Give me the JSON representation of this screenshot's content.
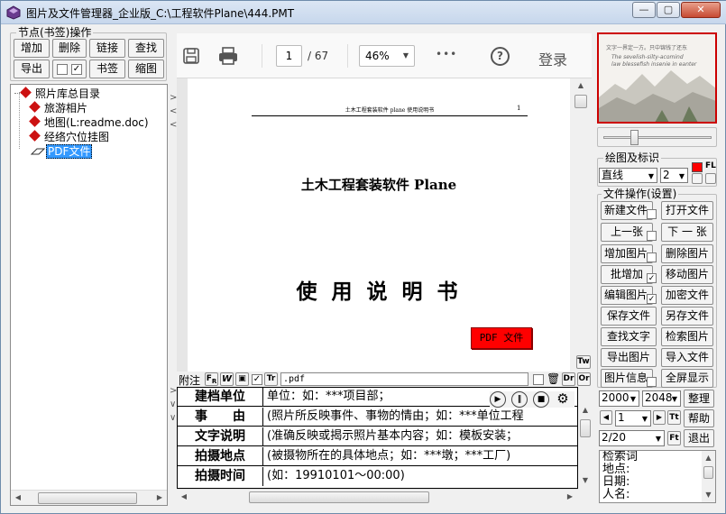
{
  "window": {
    "title": "图片及文件管理器_企业版_C:\\工程软件Plane\\444.PMT",
    "caption_min": "—",
    "caption_max": "▢",
    "caption_close": "✕"
  },
  "colors": {
    "accent_red": "#ff0000",
    "title_bar": "#c7d7ec"
  },
  "nodes": {
    "group_title": "节点(书签)操作",
    "add": "增加",
    "delete": "删除",
    "link": "链接",
    "find": "查找",
    "export": "导出",
    "bookmark": "书签",
    "thumbnail": "缩图"
  },
  "tree": {
    "root": "照片库总目录",
    "items": [
      "旅游相片",
      "地图(L:readme.doc)",
      "经络穴位挂图",
      "PDF文件"
    ]
  },
  "viewer": {
    "page_current": "1",
    "page_total": "/ 67",
    "zoom": "46%",
    "more": "•••",
    "help": "?",
    "login": "登录"
  },
  "doc": {
    "header_text": "土木工程套装软件 plane 使用说明书",
    "header_page": "1",
    "title": "土木工程套装软件 Plane",
    "subtitle": "使 用 说 明 书",
    "pdf_badge": "PDF 文件"
  },
  "attach": {
    "label": "附注",
    "ext": ".pdf",
    "tw": "Tw",
    "tr": "Tr",
    "dr": "Dr",
    "or": "Or"
  },
  "info": {
    "rows": [
      {
        "label": "建档单位",
        "value": "单位：如：***项目部；"
      },
      {
        "label": "事　　由",
        "value": "(照片所反映事件、事物的情由；如：***单位工程"
      },
      {
        "label": "文字说明",
        "value": "(准确反映或揭示照片基本内容；如：模板安装；"
      },
      {
        "label": "拍摄地点",
        "value": "(被摄物所在的具体地点；如：***墩；***工厂)"
      },
      {
        "label": "拍摄时间",
        "value": "(如：19910101～00:00)"
      }
    ]
  },
  "draw": {
    "title": "绘图及标识",
    "line_type": "直线",
    "width": "2",
    "fl": "FL"
  },
  "file": {
    "title": "文件操作(设置)",
    "buttons": [
      "新建文件",
      "打开文件",
      "上一张",
      "下 一 张",
      "增加图片",
      "删除图片",
      "批增加",
      "移动图片",
      "编辑图片",
      "加密文件",
      "保存文件",
      "另存文件",
      "查找文字",
      "检索图片",
      "导出图片",
      "导入文件",
      "图片信息",
      "全屏显示"
    ]
  },
  "bottom": {
    "year_from": "2000",
    "year_to": "2048",
    "sort": "整理",
    "page_sel": "1",
    "help": "帮助",
    "page_count": "2/20",
    "exit": "退出",
    "tt": "Tt",
    "ft": "Ft"
  },
  "search": {
    "lines": [
      "检索词",
      "地点:",
      "日期:",
      "人名:"
    ]
  },
  "thumb": {
    "line1": "文字一界定一方。只中锦钱了还东",
    "line2": "The sevelish-silty-acomind",
    "line3": "law blessefish insenie in eanter"
  }
}
